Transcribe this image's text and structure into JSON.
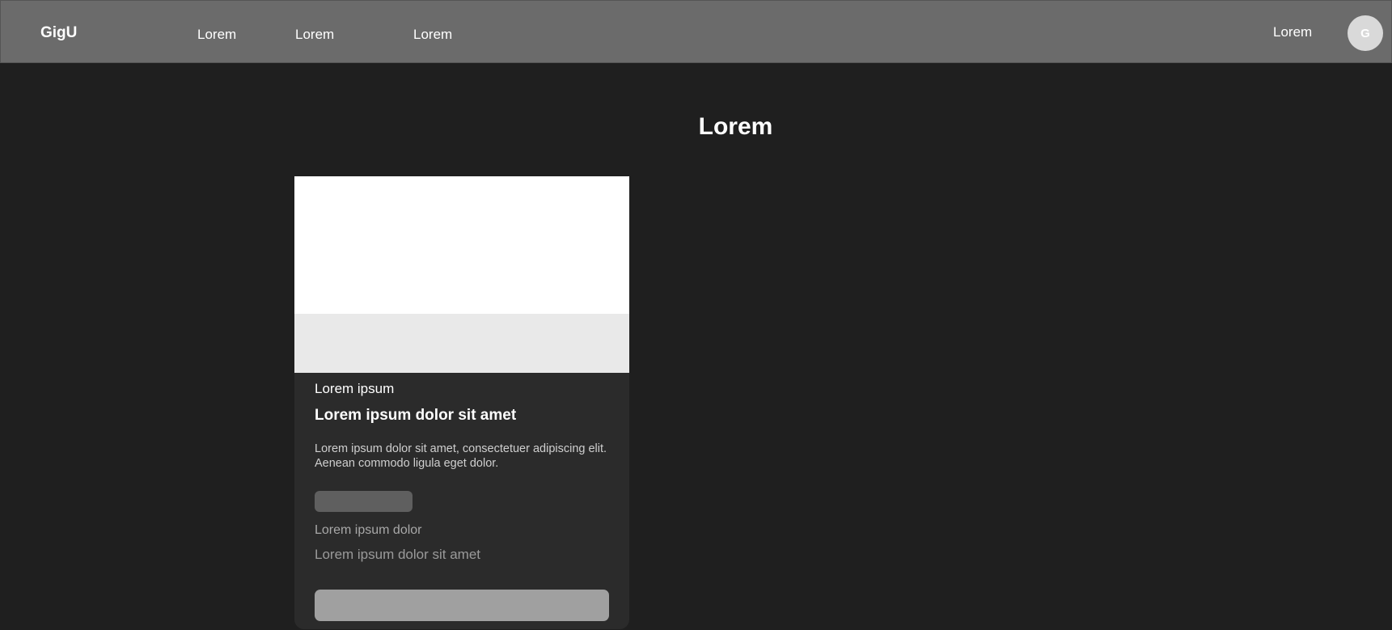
{
  "navbar": {
    "brand": "GigU",
    "links": [
      "Lorem",
      "Lorem",
      "Lorem"
    ],
    "right_link": "Lorem",
    "avatar_initial": "G"
  },
  "main": {
    "title": "Lorem",
    "card": {
      "eyebrow": "Lorem ipsum",
      "title": "Lorem ipsum dolor sit amet",
      "description": "Lorem ipsum dolor sit amet, consectetuer adipiscing elit. Aenean commodo ligula eget dolor.",
      "meta_line_1": "Lorem ipsum dolor",
      "meta_line_2": "Lorem ipsum dolor sit amet",
      "button_label": ""
    }
  },
  "colors": {
    "background": "#1f1f1f",
    "navbar": "#6b6b6b",
    "card": "#2b2b2b",
    "card_image": "#ffffff",
    "card_image_band": "#e9e9e9",
    "chip": "#5f5f5f",
    "button": "#a0a0a0",
    "avatar": "#d9d9d9"
  }
}
